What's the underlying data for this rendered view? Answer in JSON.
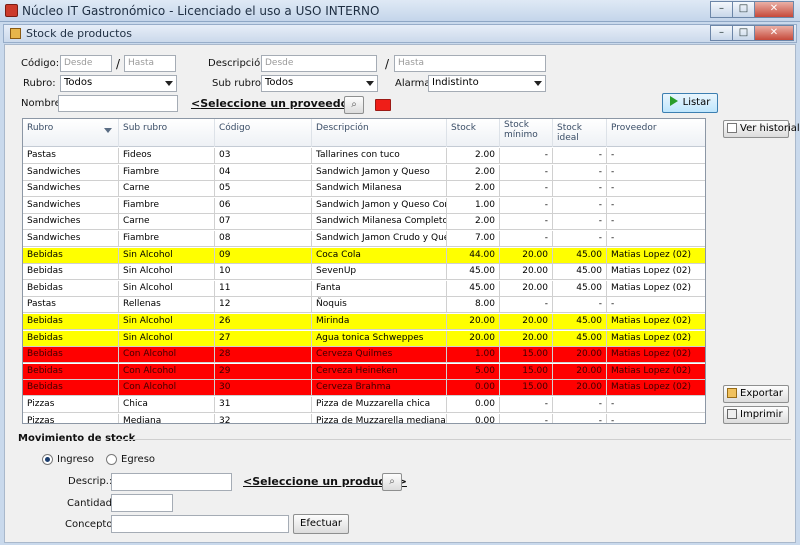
{
  "window": {
    "title": "Núcleo IT Gastronómico - Licenciado el uso a USO INTERNO",
    "min": "–",
    "max": "□",
    "close": "✕"
  },
  "form": {
    "title": "Stock de productos"
  },
  "filters": {
    "codigo_label": "Código:",
    "codigo_desde": "Desde",
    "codigo_hasta": "Hasta",
    "slash": "/",
    "descripcion_label": "Descripción:",
    "descripcion_desde": "Desde",
    "descripcion_hasta": "Hasta",
    "rubro_label": "Rubro:",
    "rubro_value": "Todos",
    "subrubro_label": "Sub rubro:",
    "subrubro_value": "Todos",
    "alarma_label": "Alarma:",
    "alarma_value": "Indistinto",
    "nombre_label": "Nombre:",
    "nombre_value": "",
    "proveedor_link": "<Seleccione un proveedor>",
    "listar_label": "Listar"
  },
  "grid": {
    "columns": [
      "Rubro",
      "Sub rubro",
      "Código",
      "Descripción",
      "Stock",
      "Stock mínimo",
      "Stock ideal",
      "Proveedor"
    ],
    "rows": [
      {
        "rubro": "Pastas",
        "subrubro": "Fideos",
        "codigo": "03",
        "descripcion": "Tallarines con tuco",
        "stock": "2.00",
        "minimo": "-",
        "ideal": "-",
        "proveedor": "-",
        "color": "white"
      },
      {
        "rubro": "Sandwiches",
        "subrubro": "Fiambre",
        "codigo": "04",
        "descripcion": "Sandwich Jamon y Queso",
        "stock": "2.00",
        "minimo": "-",
        "ideal": "-",
        "proveedor": "-",
        "color": "white"
      },
      {
        "rubro": "Sandwiches",
        "subrubro": "Carne",
        "codigo": "05",
        "descripcion": "Sandwich Milanesa",
        "stock": "2.00",
        "minimo": "-",
        "ideal": "-",
        "proveedor": "-",
        "color": "white"
      },
      {
        "rubro": "Sandwiches",
        "subrubro": "Fiambre",
        "codigo": "06",
        "descripcion": "Sandwich Jamon y Queso Com...",
        "stock": "1.00",
        "minimo": "-",
        "ideal": "-",
        "proveedor": "-",
        "color": "white"
      },
      {
        "rubro": "Sandwiches",
        "subrubro": "Carne",
        "codigo": "07",
        "descripcion": "Sandwich Milanesa Completo",
        "stock": "2.00",
        "minimo": "-",
        "ideal": "-",
        "proveedor": "-",
        "color": "white"
      },
      {
        "rubro": "Sandwiches",
        "subrubro": "Fiambre",
        "codigo": "08",
        "descripcion": "Sandwich Jamon Crudo y Queso",
        "stock": "7.00",
        "minimo": "-",
        "ideal": "-",
        "proveedor": "-",
        "color": "white"
      },
      {
        "rubro": "Bebidas",
        "subrubro": "Sin Alcohol",
        "codigo": "09",
        "descripcion": "Coca Cola",
        "stock": "44.00",
        "minimo": "20.00",
        "ideal": "45.00",
        "proveedor": "Matias Lopez (02)",
        "color": "yellow"
      },
      {
        "rubro": "Bebidas",
        "subrubro": "Sin Alcohol",
        "codigo": "10",
        "descripcion": "SevenUp",
        "stock": "45.00",
        "minimo": "20.00",
        "ideal": "45.00",
        "proveedor": "Matias Lopez (02)",
        "color": "white"
      },
      {
        "rubro": "Bebidas",
        "subrubro": "Sin Alcohol",
        "codigo": "11",
        "descripcion": "Fanta",
        "stock": "45.00",
        "minimo": "20.00",
        "ideal": "45.00",
        "proveedor": "Matias Lopez (02)",
        "color": "white"
      },
      {
        "rubro": "Pastas",
        "subrubro": "Rellenas",
        "codigo": "12",
        "descripcion": "Ñoquis",
        "stock": "8.00",
        "minimo": "-",
        "ideal": "-",
        "proveedor": "-",
        "color": "white"
      },
      {
        "rubro": "Bebidas",
        "subrubro": "Sin Alcohol",
        "codigo": "26",
        "descripcion": "Mirinda",
        "stock": "20.00",
        "minimo": "20.00",
        "ideal": "45.00",
        "proveedor": "Matias Lopez (02)",
        "color": "yellow"
      },
      {
        "rubro": "Bebidas",
        "subrubro": "Sin Alcohol",
        "codigo": "27",
        "descripcion": "Agua tonica Schweppes",
        "stock": "20.00",
        "minimo": "20.00",
        "ideal": "45.00",
        "proveedor": "Matias Lopez (02)",
        "color": "yellow"
      },
      {
        "rubro": "Bebidas",
        "subrubro": "Con Alcohol",
        "codigo": "28",
        "descripcion": "Cerveza Quilmes",
        "stock": "1.00",
        "minimo": "15.00",
        "ideal": "20.00",
        "proveedor": "Matias Lopez (02)",
        "color": "red"
      },
      {
        "rubro": "Bebidas",
        "subrubro": "Con Alcohol",
        "codigo": "29",
        "descripcion": "Cerveza Heineken",
        "stock": "5.00",
        "minimo": "15.00",
        "ideal": "20.00",
        "proveedor": "Matias Lopez (02)",
        "color": "red"
      },
      {
        "rubro": "Bebidas",
        "subrubro": "Con Alcohol",
        "codigo": "30",
        "descripcion": "Cerveza Brahma",
        "stock": "0.00",
        "minimo": "15.00",
        "ideal": "20.00",
        "proveedor": "Matias Lopez (02)",
        "color": "red"
      },
      {
        "rubro": "Pizzas",
        "subrubro": "Chica",
        "codigo": "31",
        "descripcion": "Pizza de Muzzarella chica",
        "stock": "0.00",
        "minimo": "-",
        "ideal": "-",
        "proveedor": "-",
        "color": "white"
      },
      {
        "rubro": "Pizzas",
        "subrubro": "Mediana",
        "codigo": "32",
        "descripcion": "Pizza de Muzzarella mediana",
        "stock": "0.00",
        "minimo": "-",
        "ideal": "-",
        "proveedor": "-",
        "color": "white"
      }
    ]
  },
  "side": {
    "ver_historial": "Ver historial",
    "exportar": "Exportar",
    "imprimir": "Imprimir"
  },
  "movimiento": {
    "title": "Movimiento de stock",
    "ingreso": "Ingreso",
    "egreso": "Egreso",
    "descrip_label": "Descrip.:",
    "descrip_value": "",
    "producto_link": "<Seleccione un producto>",
    "cantidad_label": "Cantidad:",
    "cantidad_value": "",
    "concepto_label": "Concepto:",
    "concepto_value": "",
    "efectuar_label": "Efectuar",
    "selected": "ingreso"
  },
  "colors": {
    "alarm_yellow": "#ffff00",
    "alarm_red": "#ff0000"
  }
}
